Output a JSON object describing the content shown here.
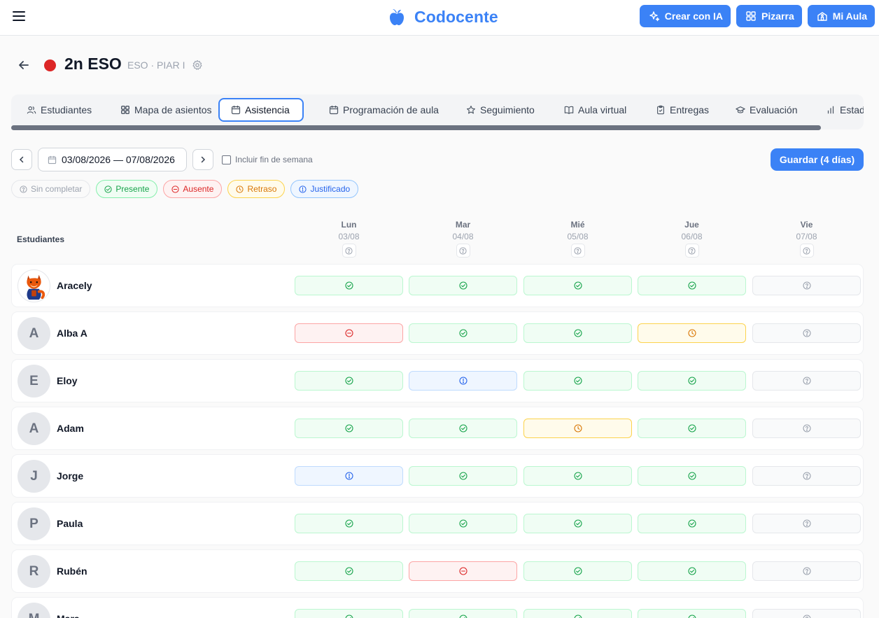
{
  "brand": {
    "name": "Codocente",
    "color": "#3b82f6"
  },
  "topbar": {
    "actions": [
      {
        "label": "Crear con IA",
        "icon": "sparkles-icon"
      },
      {
        "label": "Pizarra",
        "icon": "grid-icon"
      },
      {
        "label": "Mi Aula",
        "icon": "school-icon"
      }
    ]
  },
  "class_header": {
    "title": "2n ESO",
    "subtitle": "ESO · PIAR I",
    "dot_color": "#dc2626"
  },
  "tabs": [
    {
      "label": "Estudiantes",
      "icon": "users-icon",
      "active": false
    },
    {
      "label": "Mapa de asientos",
      "icon": "grid-icon",
      "active": false
    },
    {
      "label": "Asistencia",
      "icon": "calendar-icon",
      "active": true
    },
    {
      "label": "Programación de aula",
      "icon": "calendar-icon",
      "active": false
    },
    {
      "label": "Seguimiento",
      "icon": "star-icon",
      "active": false
    },
    {
      "label": "Aula virtual",
      "icon": "book-icon",
      "active": false
    },
    {
      "label": "Entregas",
      "icon": "clipboard-icon",
      "active": false
    },
    {
      "label": "Evaluación",
      "icon": "graduation-cap-icon",
      "active": false
    },
    {
      "label": "Estad",
      "icon": "bar-chart-icon",
      "active": false
    }
  ],
  "toolbar": {
    "date_range": "03/08/2026 — 07/08/2026",
    "weekend_label": "Incluir fin de semana",
    "weekend_checked": false,
    "save_label": "Guardar (4 días)"
  },
  "legend": [
    {
      "status": "none",
      "label": "Sin completar"
    },
    {
      "status": "present",
      "label": "Presente"
    },
    {
      "status": "absent",
      "label": "Ausente"
    },
    {
      "status": "late",
      "label": "Retraso"
    },
    {
      "status": "just",
      "label": "Justificado"
    }
  ],
  "grid": {
    "students_header": "Estudiantes",
    "days": [
      {
        "name": "Lun",
        "date": "03/08"
      },
      {
        "name": "Mar",
        "date": "04/08"
      },
      {
        "name": "Mié",
        "date": "05/08"
      },
      {
        "name": "Jue",
        "date": "06/08"
      },
      {
        "name": "Vie",
        "date": "07/08"
      }
    ],
    "students": [
      {
        "name": "Aracely",
        "initial": "",
        "avatar": "fox-avatar",
        "attendance": [
          "present",
          "present",
          "present",
          "present",
          "none"
        ]
      },
      {
        "name": "Alba A",
        "initial": "A",
        "avatar": "",
        "attendance": [
          "absent",
          "present",
          "present",
          "late",
          "none"
        ]
      },
      {
        "name": "Eloy",
        "initial": "E",
        "avatar": "",
        "attendance": [
          "present",
          "just",
          "present",
          "present",
          "none"
        ]
      },
      {
        "name": "Adam",
        "initial": "A",
        "avatar": "",
        "attendance": [
          "present",
          "present",
          "late",
          "present",
          "none"
        ]
      },
      {
        "name": "Jorge",
        "initial": "J",
        "avatar": "",
        "attendance": [
          "just",
          "present",
          "present",
          "present",
          "none"
        ]
      },
      {
        "name": "Paula",
        "initial": "P",
        "avatar": "",
        "attendance": [
          "present",
          "present",
          "present",
          "present",
          "none"
        ]
      },
      {
        "name": "Rubén",
        "initial": "R",
        "avatar": "",
        "attendance": [
          "present",
          "absent",
          "present",
          "present",
          "none"
        ]
      },
      {
        "name": "Mara",
        "initial": "M",
        "avatar": "",
        "attendance": [
          "present",
          "present",
          "present",
          "present",
          "none"
        ]
      }
    ]
  }
}
